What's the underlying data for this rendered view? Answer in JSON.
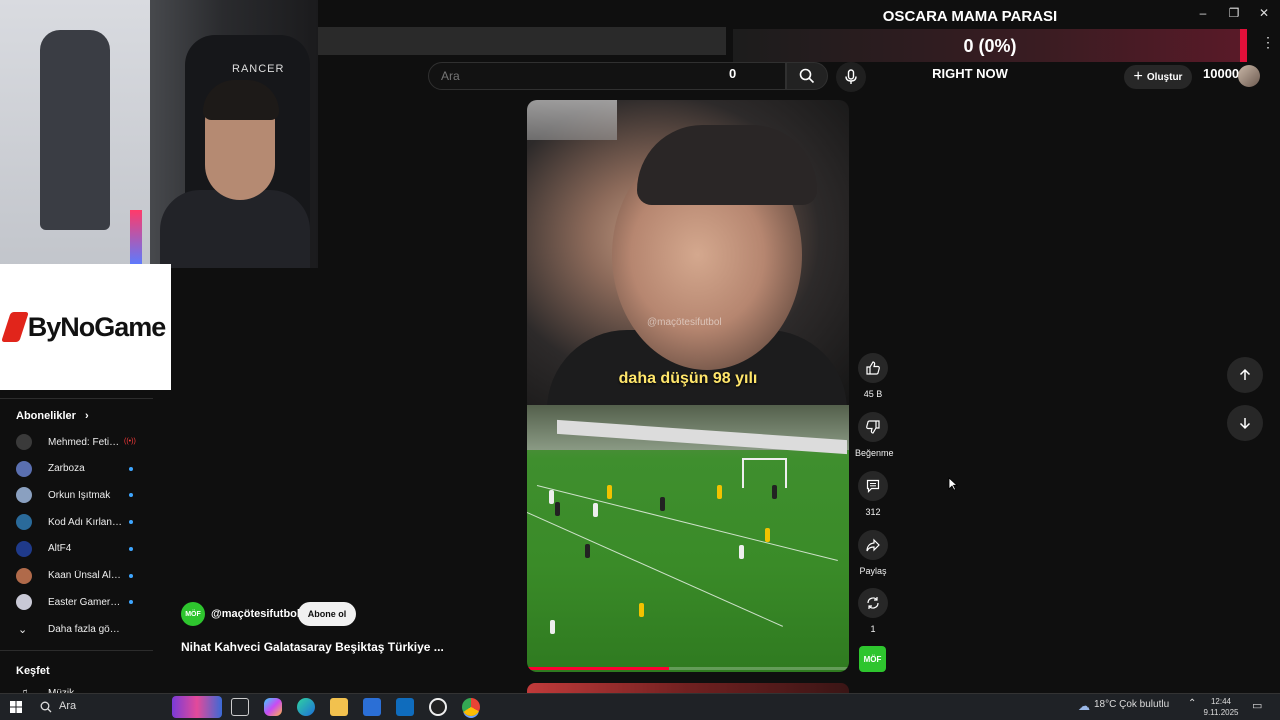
{
  "overlay": {
    "donation_title": "OSCARA MAMA PARASI",
    "donation_value": "0 (0%)",
    "donation_subtitle": "RIGHT NOW",
    "donation_goal": "10000",
    "sponsor_name": "ByNoGame",
    "webcam_chair_brand": "RANCER"
  },
  "header": {
    "search_placeholder": "Ara",
    "search_count": "0",
    "create_label": "Oluştur"
  },
  "sidebar": {
    "subscriptions_label": "Abonelikler",
    "subscriptions_arrow": "›",
    "items": [
      {
        "name": "Mehmed: Fetihle...",
        "status": "live",
        "avatar_color": "#3a3a3a"
      },
      {
        "name": "Zarboza",
        "status": "new",
        "avatar_color": "#5a6fb0"
      },
      {
        "name": "Orkun Işıtmak",
        "status": "new",
        "avatar_color": "#8aa0c0"
      },
      {
        "name": "Kod Adı Kırlangıç",
        "status": "new",
        "avatar_color": "#2a6a9a"
      },
      {
        "name": "AltF4",
        "status": "new",
        "avatar_color": "#1f3a8a"
      },
      {
        "name": "Kaan Ünsal Alph...",
        "status": "new",
        "avatar_color": "#b06a4a"
      },
      {
        "name": "Easter GamersTv",
        "status": "new",
        "avatar_color": "#c9c9d6"
      }
    ],
    "show_more_label": "Daha fazla göster",
    "explore_label": "Keşfet",
    "explore_first": "Müzik"
  },
  "video": {
    "caption": "daha düşün 98 yılı",
    "watermark": "@maçötesifutbol",
    "progress": 0.44,
    "channel_handle": "@maçötesifutbol",
    "channel_badge": "MÖF",
    "subscribe_label": "Abone ol",
    "title": "Nihat Kahveci Galatasaray Beşiktaş Türkiye ..."
  },
  "actions": {
    "like_count": "45 B",
    "dislike_label": "Beğenme",
    "comment_count": "312",
    "share_label": "Paylaş",
    "remix_count": "1"
  },
  "taskbar": {
    "search_label": "Ara",
    "weather": "18°C  Çok bulutlu",
    "time": "12:44",
    "date": "9.11.2025"
  },
  "colors": {
    "accent_red": "#ff0033",
    "channel_green": "#2ec52e",
    "caption_yellow": "#ffe66b",
    "sponsor_red": "#e1251b"
  }
}
